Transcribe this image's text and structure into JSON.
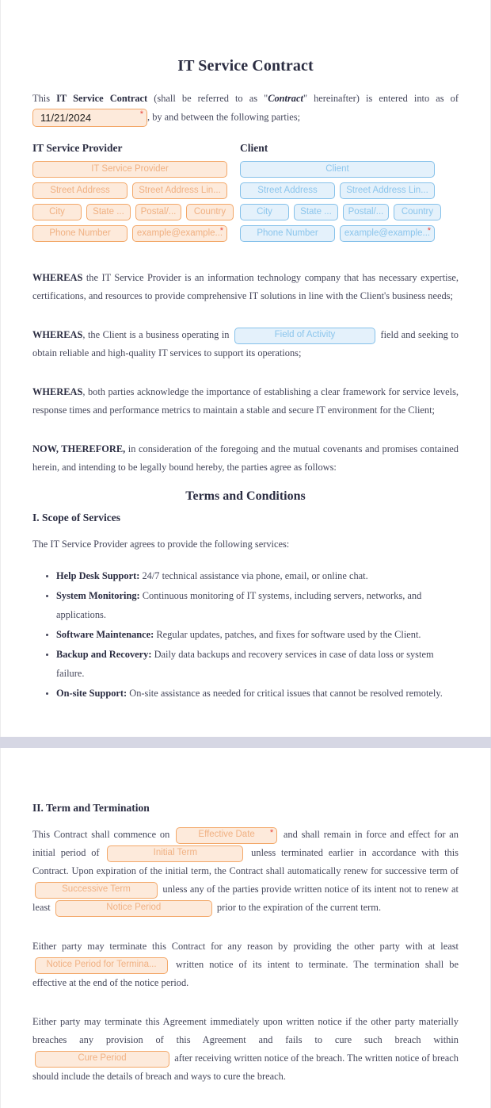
{
  "document": {
    "title": "IT Service Contract",
    "terms_heading": "Terms and Conditions"
  },
  "intro": {
    "lead": "This ",
    "contract_bold": "IT Service Contract",
    "mid": " (shall be referred to as \"",
    "contract_quoted": "Contract",
    "mid2": "\" hereinafter) is entered into as of ",
    "date_value": "11/21/2024",
    "required_marker": "*",
    "tail": ", by and between the following parties;"
  },
  "parties": {
    "provider": {
      "heading": "IT Service Provider",
      "name_placeholder": "IT Service Provider",
      "street1_placeholder": "Street Address",
      "street2_placeholder": "Street Address Lin...",
      "city_placeholder": "City",
      "state_placeholder": "State ...",
      "postal_placeholder": "Postal/...",
      "country_placeholder": "Country",
      "phone_placeholder": "Phone Number",
      "email_placeholder": "example@example...",
      "email_required": "*"
    },
    "client": {
      "heading": "Client",
      "name_placeholder": "Client",
      "street1_placeholder": "Street Address",
      "street2_placeholder": "Street Address Lin...",
      "city_placeholder": "City",
      "state_placeholder": "State ...",
      "postal_placeholder": "Postal/...",
      "country_placeholder": "Country",
      "phone_placeholder": "Phone Number",
      "email_placeholder": "example@example...",
      "email_required": "*"
    }
  },
  "recitals": {
    "one_label": "WHEREAS",
    "one_text": " the IT Service Provider is an information technology company that has necessary expertise, certifications, and resources to provide comprehensive IT solutions in line with the Client's business needs;",
    "two_label": "WHEREAS",
    "two_before": ", the Client is a business operating in ",
    "two_field_placeholder": "Field of Activity",
    "two_after": " field and seeking to obtain reliable and high-quality IT services to support its operations;",
    "three_label": "WHEREAS",
    "three_text": ", both parties acknowledge the importance of establishing a clear framework for service levels, response times and  performance metrics to maintain a stable and secure IT environment for the Client;",
    "now_label": "NOW, THEREFORE,",
    "now_text": " in consideration of the foregoing and the mutual covenants and promises contained herein, and intending to be legally bound hereby, the parties agree as follows:"
  },
  "scope": {
    "heading": "I. Scope of Services",
    "intro": "The IT Service Provider agrees to provide the following services:",
    "items": [
      {
        "label": "Help Desk Support:",
        "text": " 24/7 technical assistance via phone, email, or online chat."
      },
      {
        "label": "System Monitoring:",
        "text": " Continuous monitoring of IT systems, including servers, networks, and applications."
      },
      {
        "label": "Software Maintenance:",
        "text": " Regular updates, patches, and fixes for software used by the Client."
      },
      {
        "label": "Backup and Recovery:",
        "text": " Daily data backups and recovery services in case of data loss or system failure."
      },
      {
        "label": "On-site Support:",
        "text": " On-site assistance as needed for critical issues that cannot be resolved remotely."
      }
    ]
  },
  "term": {
    "heading": "II. Term and Termination",
    "p1_a": "This Contract shall commence on ",
    "p1_effective_placeholder": "Effective Date",
    "p1_effective_required": "*",
    "p1_b": " and shall remain in force and effect for an initial period of ",
    "p1_initial_placeholder": "Initial Term",
    "p1_c": " unless  terminated earlier in accordance with this Contract.  Upon expiration of the initial term, the Contract shall automatically renew for successive term of ",
    "p1_successive_placeholder": "Successive Term",
    "p1_d": " unless any of the parties provide written notice of its intent not to renew at least ",
    "p1_notice_placeholder": "Notice Period",
    "p1_e": " prior to the expiration of the current term.",
    "p2_a": "Either party may terminate this Contract for any reason by providing the other party with at least ",
    "p2_notice_placeholder": "Notice Period for Termina...",
    "p2_b": " written notice of its intent to terminate. The termination shall be effective at the end of the notice period.",
    "p3_a": "Either party may terminate this Agreement immediately upon written notice if the other party materially breaches any provision of this Agreement and fails to cure such breach within ",
    "p3_cure_placeholder": "Cure Period",
    "p3_b": " after receiving written notice of the breach. The written notice of breach should include the details of breach and ways to cure the breach."
  },
  "colors": {
    "accent_orange_border": "#f3a869",
    "accent_orange_fill": "#fdeadb",
    "accent_orange_text": "#f0b183",
    "accent_blue_border": "#85c1ea",
    "accent_blue_fill": "#e4f1fb",
    "accent_blue_text": "#8bc5ec",
    "required_red": "#e8453c",
    "page_break": "#d6d7e4",
    "heading_ink": "#2b2d42"
  }
}
